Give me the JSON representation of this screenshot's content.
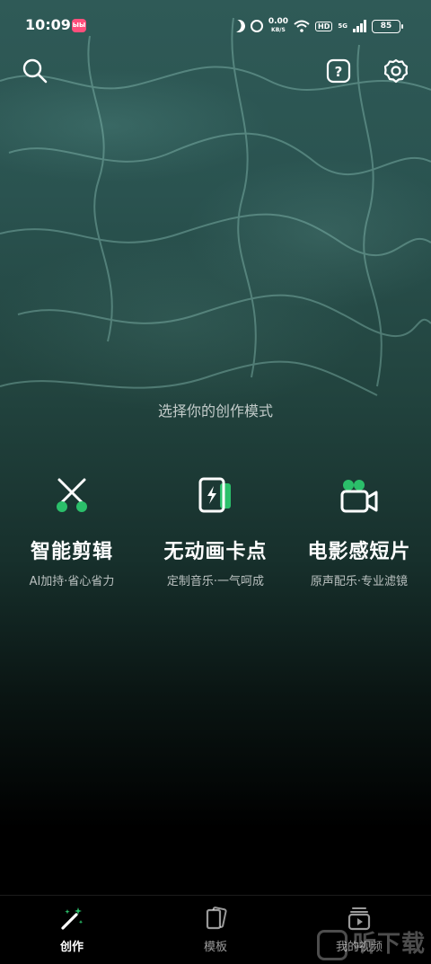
{
  "status_bar": {
    "time": "10:09",
    "app_badge": "ЫЫ",
    "net_speed": "0.00",
    "net_unit": "KB/S",
    "hd": "HD",
    "network": "5G",
    "battery": "85"
  },
  "top_bar": {
    "search_icon": "search-icon",
    "help_icon": "help-icon",
    "settings_icon": "gear-icon"
  },
  "prompt": "选择你的创作模式",
  "modes": [
    {
      "title": "智能剪辑",
      "subtitle": "AI加持·省心省力",
      "icon": "scissors-icon"
    },
    {
      "title": "无动画卡点",
      "subtitle": "定制音乐·一气呵成",
      "icon": "beat-card-icon"
    },
    {
      "title": "电影感短片",
      "subtitle": "原声配乐·专业滤镜",
      "icon": "video-camera-icon"
    }
  ],
  "bottom_nav": [
    {
      "label": "创作",
      "icon": "magic-wand-icon",
      "active": true
    },
    {
      "label": "模板",
      "icon": "template-cards-icon",
      "active": false
    },
    {
      "label": "我的视频",
      "icon": "my-videos-icon",
      "active": false
    }
  ],
  "watermark": "听下载",
  "colors": {
    "accent_green": "#2bbf6a",
    "app_badge": "#ff4f7c"
  }
}
